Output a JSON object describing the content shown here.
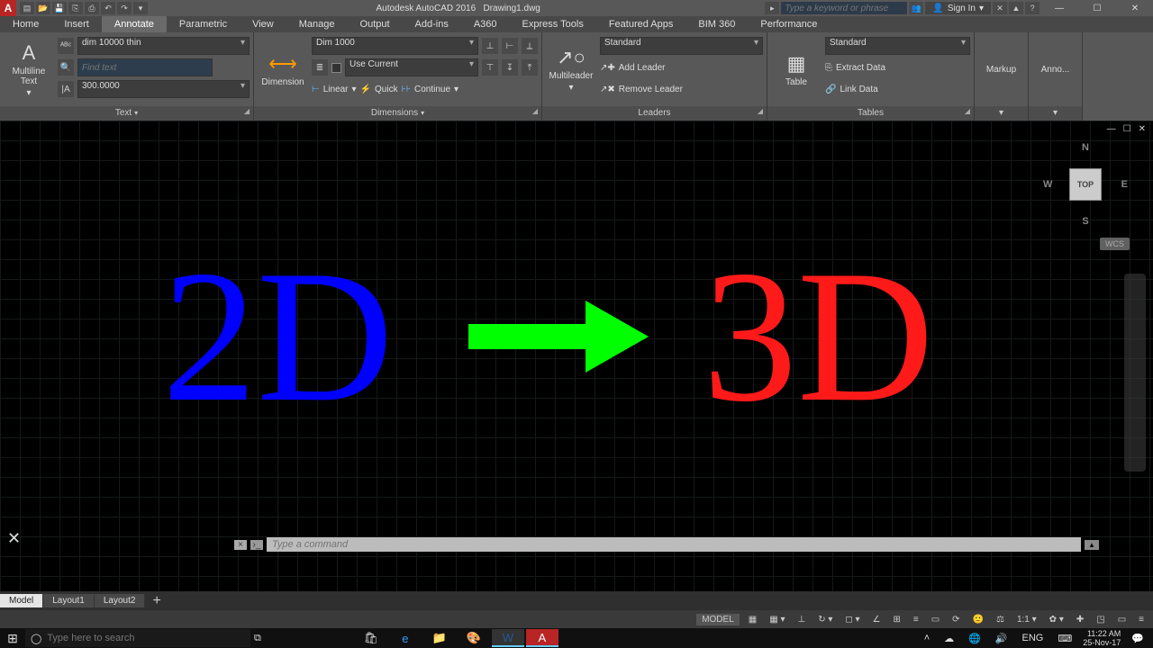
{
  "title": {
    "app": "Autodesk AutoCAD 2016",
    "doc": "Drawing1.dwg"
  },
  "search_keyword_placeholder": "Type a keyword or phrase",
  "signin": "Sign In",
  "window_controls": {
    "min": "—",
    "max": "☐",
    "close": "✕"
  },
  "menu": [
    "Home",
    "Insert",
    "Annotate",
    "Parametric",
    "View",
    "Manage",
    "Output",
    "Add-ins",
    "A360",
    "Express Tools",
    "Featured Apps",
    "BIM 360",
    "Performance"
  ],
  "menu_active": "Annotate",
  "ribbon": {
    "text": {
      "title": "Text",
      "big": "Multiline\nText",
      "style": "dim 10000 thin",
      "find_placeholder": "Find text",
      "height": "300.0000"
    },
    "dimensions": {
      "title": "Dimensions",
      "big": "Dimension",
      "style": "Dim 1000",
      "use_current": "Use Current",
      "linear": "Linear",
      "quick": "Quick",
      "continue": "Continue"
    },
    "leaders": {
      "title": "Leaders",
      "big": "Multileader",
      "style": "Standard",
      "add": "Add Leader",
      "remove": "Remove Leader"
    },
    "tables": {
      "title": "Tables",
      "big": "Table",
      "style": "Standard",
      "extract": "Extract Data",
      "link": "Link Data"
    },
    "markup": "Markup",
    "anno": "Anno..."
  },
  "canvas": {
    "text2d": "2D",
    "text3d": "3D",
    "viewcube": {
      "top": "TOP",
      "n": "N",
      "s": "S",
      "e": "E",
      "w": "W"
    },
    "wcs": "WCS"
  },
  "command_placeholder": "Type a command",
  "layout_tabs": [
    "Model",
    "Layout1",
    "Layout2"
  ],
  "layout_active": "Model",
  "status": {
    "model": "MODEL",
    "scale": "1:1",
    "lang": "ENG"
  },
  "taskbar": {
    "search_placeholder": "Type here to search",
    "time": "11:22 AM",
    "date": "25-Nov-17"
  }
}
